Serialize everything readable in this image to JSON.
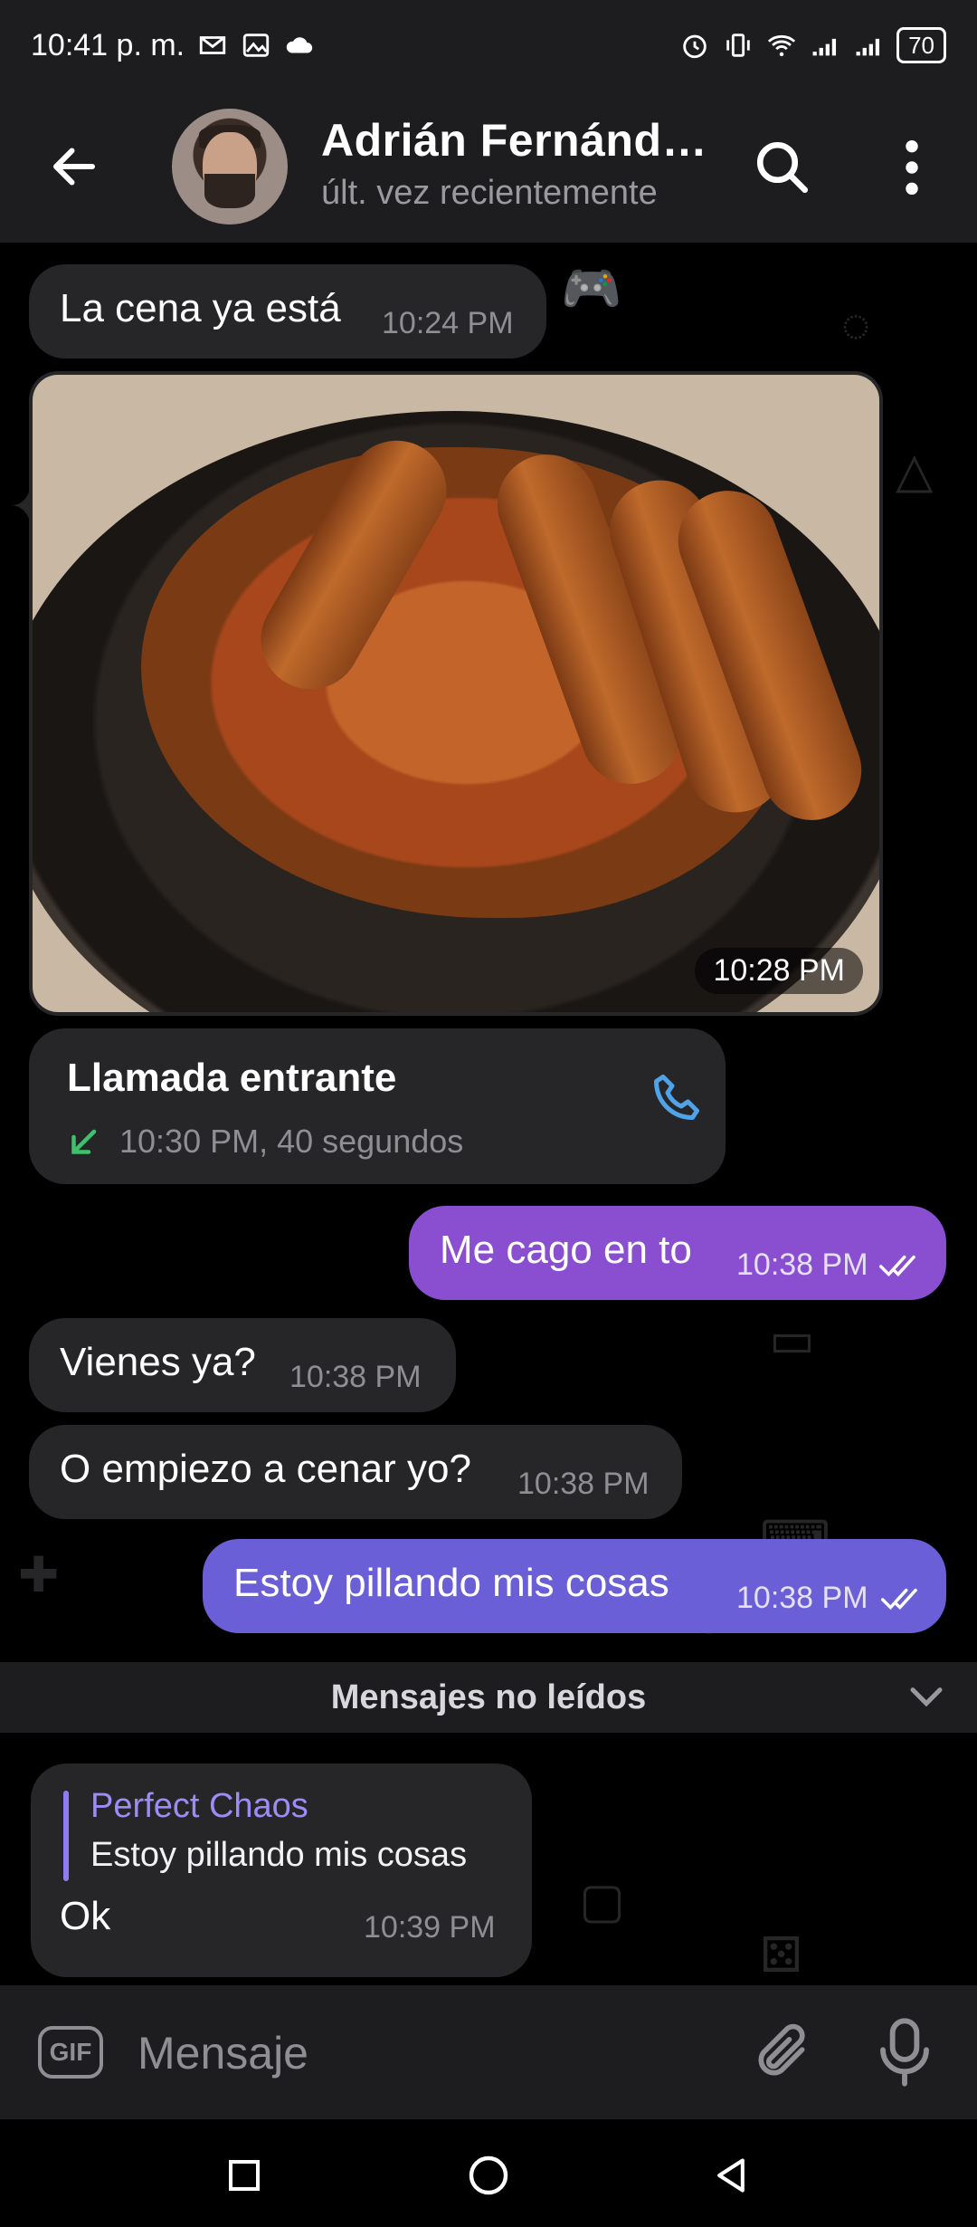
{
  "status_bar": {
    "time": "10:41 p. m.",
    "battery": "70"
  },
  "header": {
    "contact_name": "Adrián Fernánd…",
    "last_seen": "últ. vez recientemente"
  },
  "messages": [
    {
      "text": "La cena ya está",
      "time": "10:24 PM",
      "direction": "in"
    },
    {
      "photo_time": "10:28 PM",
      "direction": "in"
    },
    {
      "call_title": "Llamada entrante",
      "call_meta": "10:30 PM, 40 segundos",
      "direction": "in"
    },
    {
      "text": "Me cago en to",
      "time": "10:38 PM",
      "direction": "out"
    },
    {
      "text": "Vienes ya?",
      "time": "10:38 PM",
      "direction": "in"
    },
    {
      "text": "O empiezo a cenar yo?",
      "time": "10:38 PM",
      "direction": "in"
    },
    {
      "text": "Estoy pillando mis cosas",
      "time": "10:38 PM",
      "direction": "out"
    }
  ],
  "unread_divider": "Mensajes no leídos",
  "reply_message": {
    "quoted_author": "Perfect Chaos",
    "quoted_text": "Estoy pillando mis cosas",
    "text": "Ok",
    "time": "10:39 PM"
  },
  "composer": {
    "gif_label": "GIF",
    "placeholder": "Mensaje"
  },
  "colors": {
    "background": "#000000",
    "bar": "#1d1d1f",
    "bubble_in": "#262629",
    "bubble_out_1": "#8a4fd0",
    "bubble_out_2": "#6a5fd6",
    "accent_link": "#9b8cf6",
    "call_icon": "#4fa3e8",
    "call_arrow": "#3ec16a"
  }
}
